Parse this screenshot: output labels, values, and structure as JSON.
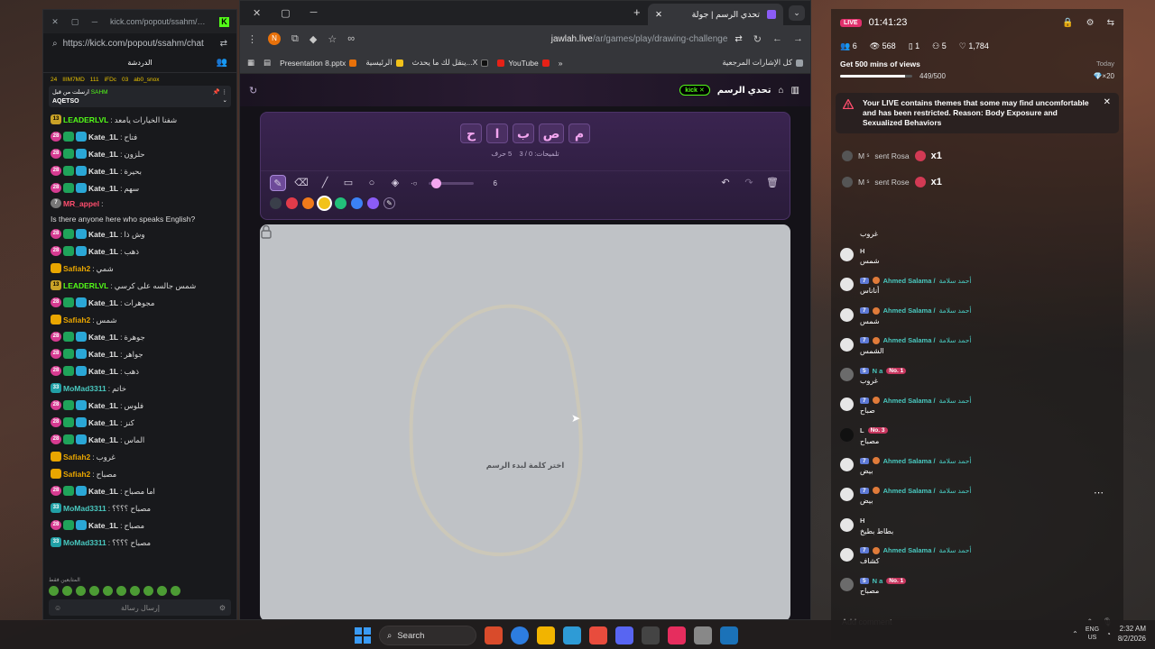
{
  "kick": {
    "tab_title": "kick.com/popout/ssahm/ch...",
    "url": "https://kick.com/popout/ssahm/chat",
    "header": "الدردشة",
    "userbar": [
      "24",
      "IIIM7MD",
      "111",
      "iFDc",
      "03",
      "ab0_snox"
    ],
    "pinned_label": "ارسلت من قبل",
    "pinned_user": "SAHM",
    "pinned_text": "AQETSO",
    "messages": [
      {
        "type": "lvl",
        "badge": "13",
        "user": "LEADERLVL",
        "color": "#53fc18",
        "text": "شفنا الخيارات يامعد"
      },
      {
        "type": "sub",
        "badge": "28",
        "user": "Kate_1L",
        "color": "#e6e6e6",
        "text": "فتاح"
      },
      {
        "type": "sub",
        "badge": "28",
        "user": "Kate_1L",
        "color": "#e6e6e6",
        "text": "حلزون"
      },
      {
        "type": "sub",
        "badge": "28",
        "user": "Kate_1L",
        "color": "#e6e6e6",
        "text": "بحيرة"
      },
      {
        "type": "sub",
        "badge": "28",
        "user": "Kate_1L",
        "color": "#e6e6e6",
        "text": "سهم"
      },
      {
        "type": "circle",
        "badge": "7",
        "user": "MR_appel",
        "color": "#ff4d6d",
        "text": "Is there anyone here who speaks English?",
        "long": true
      },
      {
        "type": "sub",
        "badge": "28",
        "user": "Kate_1L",
        "color": "#e6e6e6",
        "text": "وش ذا"
      },
      {
        "type": "sub",
        "badge": "28",
        "user": "Kate_1L",
        "color": "#e6e6e6",
        "text": "ذهب"
      },
      {
        "type": "crown",
        "badge": "",
        "user": "Safiah2",
        "color": "#e9a600",
        "text": "شمي"
      },
      {
        "type": "lvl",
        "badge": "13",
        "user": "LEADERLVL",
        "color": "#53fc18",
        "text": "شمس جالسه على كرسي"
      },
      {
        "type": "sub",
        "badge": "28",
        "user": "Kate_1L",
        "color": "#e6e6e6",
        "text": "مجوهرات"
      },
      {
        "type": "crown",
        "badge": "",
        "user": "Safiah2",
        "color": "#e9a600",
        "text": "شمس"
      },
      {
        "type": "sub",
        "badge": "28",
        "user": "Kate_1L",
        "color": "#e6e6e6",
        "text": "جوهرة"
      },
      {
        "type": "sub",
        "badge": "28",
        "user": "Kate_1L",
        "color": "#e6e6e6",
        "text": "جواهر"
      },
      {
        "type": "sub",
        "badge": "28",
        "user": "Kate_1L",
        "color": "#e6e6e6",
        "text": "ذهب"
      },
      {
        "type": "sh",
        "badge": "33",
        "user": "MoMad3311",
        "color": "#49c9c0",
        "text": "خاتم"
      },
      {
        "type": "sub",
        "badge": "28",
        "user": "Kate_1L",
        "color": "#e6e6e6",
        "text": "فلوس"
      },
      {
        "type": "sub",
        "badge": "28",
        "user": "Kate_1L",
        "color": "#e6e6e6",
        "text": "كنز"
      },
      {
        "type": "sub",
        "badge": "28",
        "user": "Kate_1L",
        "color": "#e6e6e6",
        "text": "الماس"
      },
      {
        "type": "crown",
        "badge": "",
        "user": "Safiah2",
        "color": "#e9a600",
        "text": "غروب"
      },
      {
        "type": "crown",
        "badge": "",
        "user": "Safiah2",
        "color": "#e9a600",
        "text": "مصباح"
      },
      {
        "type": "sub",
        "badge": "28",
        "user": "Kate_1L",
        "color": "#e6e6e6",
        "text": "اما مصباح"
      },
      {
        "type": "sh",
        "badge": "33",
        "user": "MoMad3311",
        "color": "#49c9c0",
        "text": "مصباح ؟؟؟؟"
      },
      {
        "type": "sub",
        "badge": "28",
        "user": "Kate_1L",
        "color": "#e6e6e6",
        "text": "مصباح"
      },
      {
        "type": "sh",
        "badge": "33",
        "user": "MoMad3311",
        "color": "#49c9c0",
        "text": "مصباح ؟؟؟؟"
      }
    ],
    "emote_label": "المتابعين فقط",
    "input_placeholder": "إرسال رسالة"
  },
  "browser": {
    "tab_title": "تحدي الرسم | جولة",
    "profile_letter": "N",
    "url_host": "jawlah.live",
    "url_path": "/ar/games/play/drawing-challenge",
    "bookmarks": [
      "كل الإشارات المرجعية",
      "YouTube",
      "ينقل لك ما يحدث...X",
      "الرئيسية",
      "Presentation 8.pptx"
    ]
  },
  "game": {
    "title": "تحدي الرسم",
    "kick_pill": "kick",
    "letters": [
      "م",
      "ص",
      "ب",
      "ا",
      "ح"
    ],
    "letters_count": "5 حرف",
    "hints": "تلميحات: 0 / 3",
    "brush_size": "6",
    "brush_level": 0.1,
    "colors": [
      "#3a3f4a",
      "#e23b4a",
      "#f07a1a",
      "#f2c21a",
      "#22c07a",
      "#3b82f6",
      "#8b5cf6"
    ],
    "selected_color": 3,
    "canvas_hint": "اختر كلمة لبدء الرسم"
  },
  "live": {
    "badge": "LIVE",
    "time": "01:41:23",
    "stats": {
      "viewers": "6",
      "views": "568",
      "shares": "1",
      "new_followers": "5",
      "likes": "1,784"
    },
    "goal_title": "Get 500 mins of views",
    "goal_today": "Today",
    "goal_count": "449/500",
    "goal_progress": 0.898,
    "goal_reward": "×20",
    "restriction": "Your LIVE contains themes that some may find uncomfortable and has been restricted. Reason: Body Exposure and Sexualized Behaviors",
    "gifts": [
      {
        "user": "M ˢ",
        "text": "sent Rosa",
        "mult": "x1"
      },
      {
        "user": "M ˢ",
        "text": "sent Rose",
        "mult": "x1"
      }
    ],
    "first_text": "غروب",
    "comments": [
      {
        "av": "light",
        "lvl": "",
        "name": "H",
        "name_ar": "",
        "no": "",
        "text": "شمس"
      },
      {
        "av": "light",
        "lvl": "7",
        "name": "Ahmed Salama /",
        "name_ar": "أحمد سلامة",
        "no": "",
        "text": "أناناس"
      },
      {
        "av": "light",
        "lvl": "7",
        "name": "Ahmed Salama /",
        "name_ar": "أحمد سلامة",
        "no": "",
        "text": "شمس"
      },
      {
        "av": "light",
        "lvl": "7",
        "name": "Ahmed Salama /",
        "name_ar": "أحمد سلامة",
        "no": "",
        "text": "الشمس"
      },
      {
        "av": "img",
        "lvl": "5",
        "name": "N a",
        "name_ar": "",
        "no": "No. 1",
        "text": "غروب"
      },
      {
        "av": "light",
        "lvl": "7",
        "name": "Ahmed Salama /",
        "name_ar": "أحمد سلامة",
        "no": "",
        "text": "صباح"
      },
      {
        "av": "dark",
        "lvl": "",
        "name": "L",
        "name_ar": "",
        "no": "No. 3",
        "text": "مصباح"
      },
      {
        "av": "light",
        "lvl": "7",
        "name": "Ahmed Salama /",
        "name_ar": "أحمد سلامة",
        "no": "",
        "text": "بيض"
      },
      {
        "av": "light",
        "lvl": "7",
        "name": "Ahmed Salama /",
        "name_ar": "أحمد سلامة",
        "no": "",
        "text": "بيض"
      },
      {
        "av": "light",
        "lvl": "",
        "name": "H",
        "name_ar": "",
        "no": "",
        "text": "بطاط بطيخ"
      },
      {
        "av": "light",
        "lvl": "7",
        "name": "Ahmed Salama /",
        "name_ar": "أحمد سلامة",
        "no": "",
        "text": "كشاف"
      },
      {
        "av": "img",
        "lvl": "5",
        "name": "N a",
        "name_ar": "",
        "no": "No. 1",
        "text": "مصباح"
      }
    ],
    "comment_placeholder": "Add comment"
  },
  "taskbar": {
    "search": "Search",
    "lang1": "ENG",
    "lang2": "US",
    "time": "2:32 AM",
    "date": "8/2/2026",
    "apps": [
      "#d94b2b",
      "#2d7de0",
      "#f2b400",
      "#2e9bd6",
      "#e84c3d",
      "#5865f2",
      "#444",
      "#e62d5e",
      "#888",
      "#1b72b8"
    ]
  }
}
